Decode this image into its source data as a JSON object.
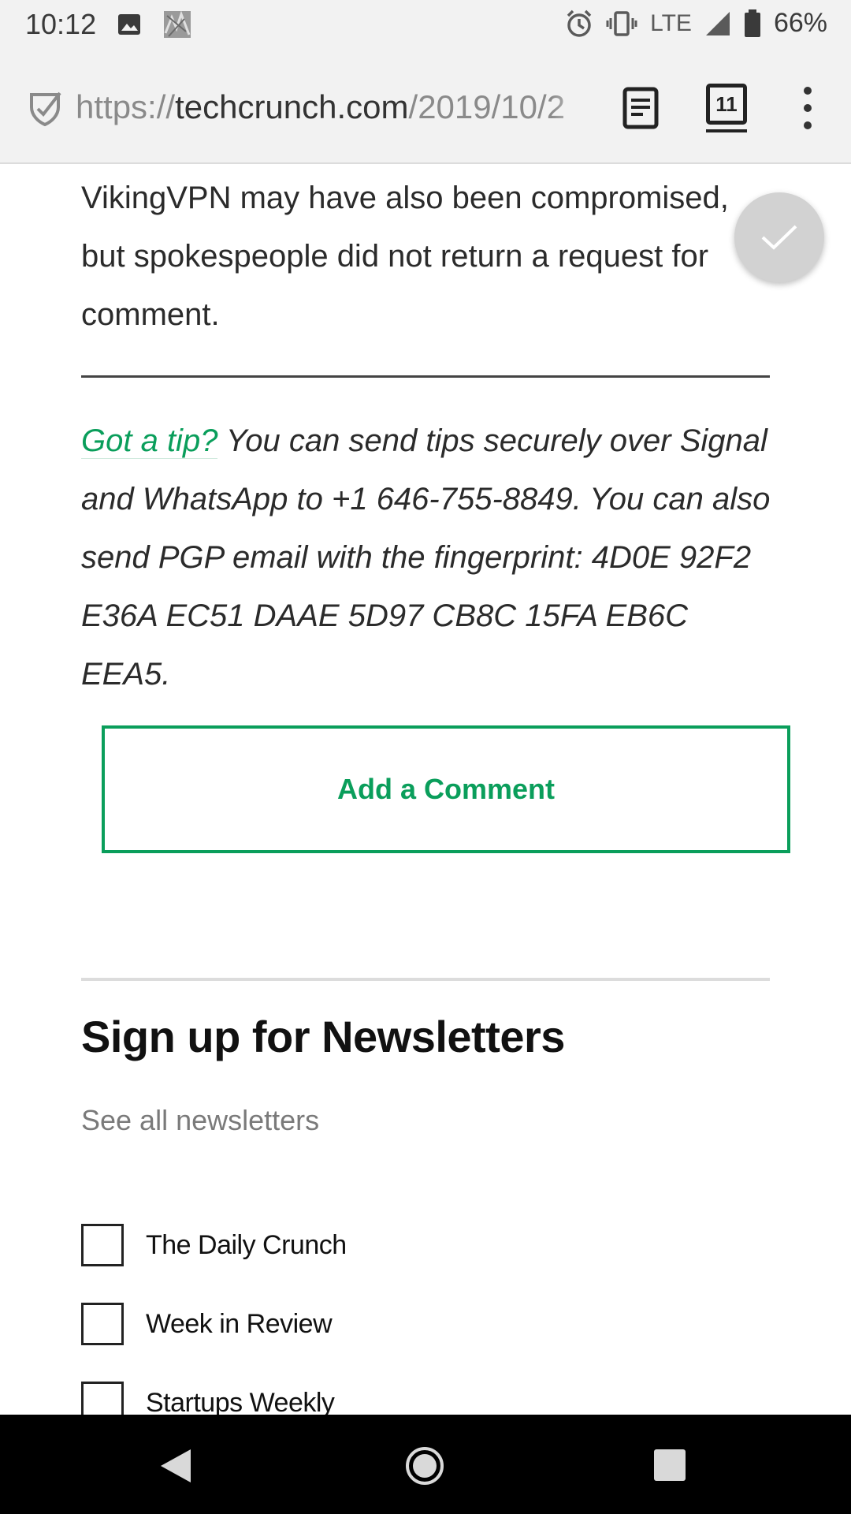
{
  "status_bar": {
    "time": "10:12",
    "network": "LTE",
    "battery": "66%",
    "icons": [
      "image-icon",
      "photo-thumbnail-icon",
      "alarm-icon",
      "vibrate-icon",
      "signal-icon",
      "battery-icon"
    ]
  },
  "browser": {
    "url_scheme": "https://",
    "url_host": "techcrunch.com",
    "url_path": "/2019/10/2",
    "tab_count": "11"
  },
  "article": {
    "paragraph": "VikingVPN may have also been compromised, but spokespeople did not return a request for comment.",
    "tip_link": "Got a tip?",
    "tip_text": " You can send tips securely over Signal and WhatsApp to +1 646-755-8849. You can also send PGP email with the fingerprint: 4D0E 92F2 E36A EC51 DAAE 5D97 CB8C 15FA EB6C EEA5."
  },
  "comment_button": "Add a Comment",
  "newsletters": {
    "title": "Sign up for Newsletters",
    "see_all": "See all newsletters",
    "items": [
      {
        "label": "The Daily Crunch"
      },
      {
        "label": "Week in Review"
      },
      {
        "label": "Startups Weekly"
      }
    ]
  },
  "colors": {
    "accent": "#0a9e5b",
    "status_bar_bg": "#f2f2f2",
    "nav_bar_bg": "#000000"
  }
}
